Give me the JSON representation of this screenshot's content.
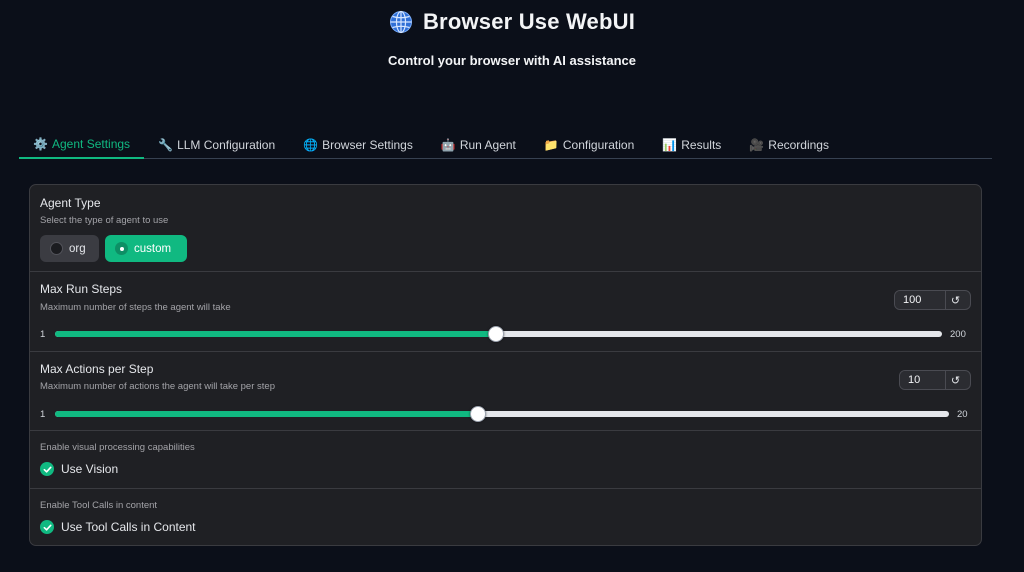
{
  "header": {
    "title": "Browser Use WebUI",
    "title_icon": "globe-icon",
    "subtitle": "Control your browser with AI assistance"
  },
  "tabs": [
    {
      "label": "Agent Settings",
      "icon": "⚙️",
      "active": true
    },
    {
      "label": "LLM Configuration",
      "icon": "🔧",
      "active": false
    },
    {
      "label": "Browser Settings",
      "icon": "🌐",
      "active": false
    },
    {
      "label": "Run Agent",
      "icon": "🤖",
      "active": false
    },
    {
      "label": "Configuration",
      "icon": "📁",
      "active": false
    },
    {
      "label": "Results",
      "icon": "📊",
      "active": false
    },
    {
      "label": "Recordings",
      "icon": "🎥",
      "active": false
    }
  ],
  "agent_type": {
    "label": "Agent Type",
    "info": "Select the type of agent to use",
    "options": [
      "org",
      "custom"
    ],
    "selected": "custom"
  },
  "max_run_steps": {
    "label": "Max Run Steps",
    "info": "Maximum number of steps the agent will take",
    "value": "100",
    "min": "1",
    "max": "200",
    "value_num": 100,
    "min_num": 1,
    "max_num": 200,
    "reset_icon": "↺"
  },
  "max_actions": {
    "label": "Max Actions per Step",
    "info": "Maximum number of actions the agent will take per step",
    "value": "10",
    "min": "1",
    "max": "20",
    "value_num": 10,
    "min_num": 1,
    "max_num": 20,
    "reset_icon": "↺"
  },
  "use_vision": {
    "info": "Enable visual processing capabilities",
    "label": "Use Vision",
    "checked": true
  },
  "tool_calls": {
    "info": "Enable Tool Calls in content",
    "label": "Use Tool Calls in Content",
    "checked": true
  },
  "colors": {
    "accent": "#10b981",
    "background": "#0b0f19",
    "panel": "#1f2024"
  }
}
